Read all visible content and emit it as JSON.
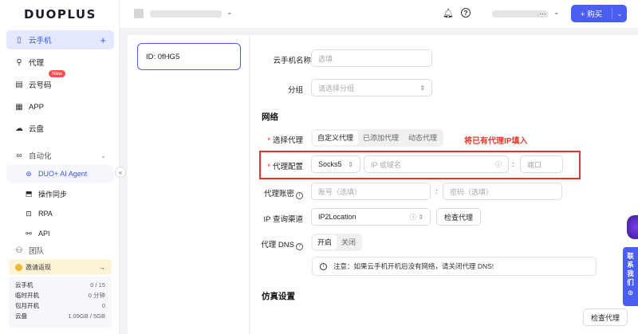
{
  "brand": {
    "logo": "DUOPLUS"
  },
  "sidebar": {
    "items": [
      {
        "label": "云手机",
        "icon": "phone-icon"
      },
      {
        "label": "代理",
        "icon": "proxy-icon"
      },
      {
        "label": "云号码",
        "icon": "number-icon",
        "badge": "New"
      },
      {
        "label": "APP",
        "icon": "app-grid-icon"
      },
      {
        "label": "云盘",
        "icon": "cloud-icon"
      },
      {
        "label": "自动化",
        "icon": "automation-icon"
      }
    ],
    "plus": "+",
    "sub_items": [
      {
        "label": "DUO+ AI Agent"
      },
      {
        "label": "操作同步"
      },
      {
        "label": "RPA"
      },
      {
        "label": "API"
      }
    ],
    "partial_item": "团队",
    "invite": {
      "label": "邀请返现",
      "arrow": "→"
    },
    "stats": [
      {
        "label": "云手机",
        "value": "0 / 15"
      },
      {
        "label": "临时开机",
        "value": "0 分钟"
      },
      {
        "label": "包月开机",
        "value": "0"
      },
      {
        "label": "云盘",
        "value": "1.09GB / 5GB"
      }
    ],
    "collapse": "«"
  },
  "topbar": {
    "buy": "+ 购买",
    "help": "?"
  },
  "device": {
    "id": "ID: 0fHG5"
  },
  "form": {
    "name_label": "云手机名称",
    "name_placeholder": "选填",
    "group_label": "分组",
    "group_placeholder": "请选择分组",
    "network_title": "网络",
    "proxy_select_label": "选择代理",
    "proxy_tabs": [
      "自定义代理",
      "已添加代理",
      "动态代理"
    ],
    "annotation": "将已有代理IP填入",
    "proxy_config_label": "代理配置",
    "protocol": "Socks5",
    "host_placeholder": "IP 或域名",
    "port_placeholder": "端口",
    "account_label": "代理账密",
    "user_placeholder": "账号（选填）",
    "pass_placeholder": "密码（选填）",
    "ip_channel_label": "IP 查询渠道",
    "ip_channel_value": "IP2Location",
    "check_proxy": "检查代理",
    "dns_label": "代理 DNS",
    "dns_options": [
      "开启",
      "关闭"
    ],
    "dns_note": "注意：如果云手机开机后没有网络，请关闭代理 DNS!",
    "emulation_title": "仿真设置",
    "bottom_check": "检查代理"
  },
  "float_tab": "联系我们"
}
